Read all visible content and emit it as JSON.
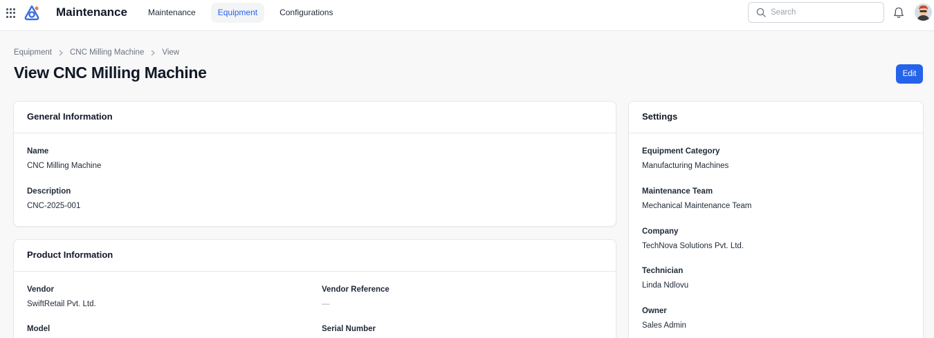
{
  "header": {
    "app_title": "Maintenance",
    "nav": [
      {
        "label": "Maintenance",
        "active": false
      },
      {
        "label": "Equipment",
        "active": true
      },
      {
        "label": "Configurations",
        "active": false
      }
    ],
    "search_placeholder": "Search",
    "icons": [
      "apps-grid-icon",
      "logo-icon",
      "search-icon",
      "bell-icon",
      "avatar"
    ]
  },
  "breadcrumb": [
    "Equipment",
    "CNC Milling Machine",
    "View"
  ],
  "page": {
    "title": "View CNC Milling Machine",
    "edit_label": "Edit"
  },
  "general": {
    "title": "General Information",
    "name_label": "Name",
    "name_value": "CNC Milling Machine",
    "description_label": "Description",
    "description_value": "CNC-2025-001"
  },
  "product": {
    "title": "Product Information",
    "vendor_label": "Vendor",
    "vendor_value": "SwiftRetail Pvt. Ltd.",
    "vendor_ref_label": "Vendor Reference",
    "vendor_ref_value": "—",
    "model_label": "Model",
    "serial_label": "Serial Number"
  },
  "settings": {
    "title": "Settings",
    "fields": [
      {
        "label": "Equipment Category",
        "value": "Manufacturing Machines"
      },
      {
        "label": "Maintenance Team",
        "value": "Mechanical Maintenance Team"
      },
      {
        "label": "Company",
        "value": "TechNova Solutions Pvt. Ltd."
      },
      {
        "label": "Technician",
        "value": "Linda Ndlovu"
      },
      {
        "label": "Owner",
        "value": "Sales Admin"
      }
    ]
  },
  "colors": {
    "accent": "#2563eb",
    "background": "#f8f8f9",
    "border": "#e5e7eb"
  }
}
